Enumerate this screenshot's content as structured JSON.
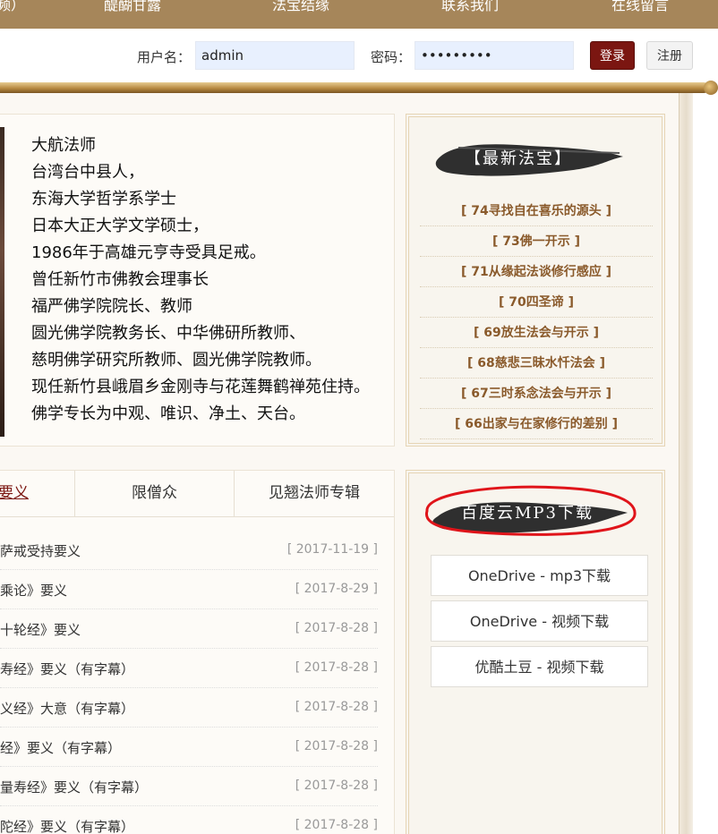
{
  "nav": {
    "items": [
      "频）",
      "醍醐甘露",
      "法宝结缘",
      "联系我们",
      "在线留言"
    ]
  },
  "login": {
    "username_label": "用户名：",
    "username_value": "admin",
    "password_label": "密码：",
    "password_value": "•••••••••",
    "login_button": "登录",
    "register_button": "注册"
  },
  "bio": {
    "lines": [
      "大航法师",
      "台湾台中县人，",
      "东海大学哲学系学士",
      "日本大正大学文学硕士，",
      "1986年于高雄元亨寺受具足戒。",
      "曾任新竹市佛教会理事长",
      "福严佛学院院长、教师",
      "圆光佛学院教务长、中华佛研所教师、",
      "慈明佛学研究所教师、圆光佛学院教师。",
      "现任新竹县峨眉乡金刚寺与花莲舞鹤禅苑住持。",
      "佛学专长为中观、唯识、净土、天台。"
    ]
  },
  "tabs": [
    {
      "label": "要义"
    },
    {
      "label": "限僧众"
    },
    {
      "label": "见翘法师专辑"
    }
  ],
  "list": [
    {
      "title": "萨戒受持要义",
      "date": "[ 2017-11-19 ]"
    },
    {
      "title": "乘论》要义",
      "date": "[ 2017-8-29 ]"
    },
    {
      "title": "十轮经》要义",
      "date": "[ 2017-8-28 ]"
    },
    {
      "title": "寿经》要义（有字幕）",
      "date": "[ 2017-8-28 ]"
    },
    {
      "title": "义经》大意（有字幕）",
      "date": "[ 2017-8-28 ]"
    },
    {
      "title": "经》要义（有字幕）",
      "date": "[ 2017-8-28 ]"
    },
    {
      "title": "量寿经》要义（有字幕）",
      "date": "[ 2017-8-28 ]"
    },
    {
      "title": "陀经》要义（有字幕）",
      "date": "[ 2017-8-28 ]"
    }
  ],
  "latest": {
    "title": "【最新法宝】",
    "items": [
      "[ 74寻找自在喜乐的源头 ]",
      "[ 73佛一开示 ]",
      "[ 71从缘起法谈修行感应 ]",
      "[ 70四圣谛 ]",
      "[ 69放生法会与开示 ]",
      "[ 68慈悲三昧水忏法会 ]",
      "[ 67三时系念法会与开示 ]",
      "[ 66出家与在家修行的差别 ]"
    ]
  },
  "downloads": {
    "title": "百度云MP3下载",
    "buttons": [
      "OneDrive - mp3下载",
      "OneDrive - 视频下载",
      "优酷土豆 - 视频下载"
    ]
  },
  "colors": {
    "nav_bg": "#a6865a",
    "login_button": "#7b1611",
    "link_brown": "#8a5a2b",
    "highlight_circle": "#e0141a"
  }
}
